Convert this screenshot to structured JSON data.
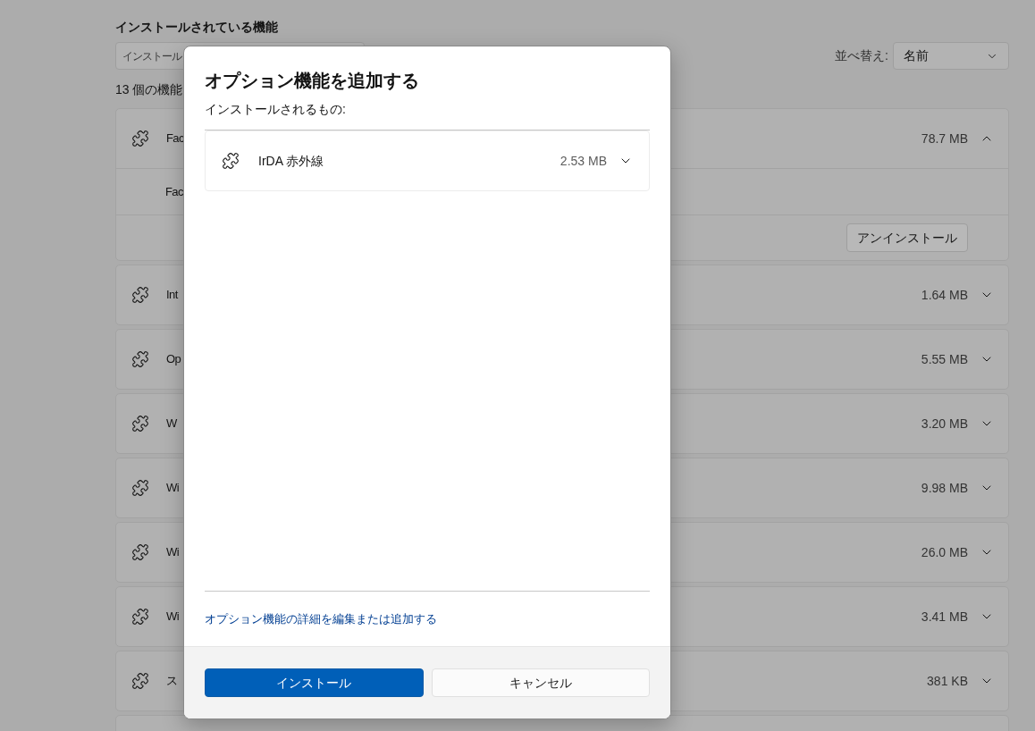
{
  "page": {
    "heading": "インストールされている機能",
    "search": {
      "placeholder": "インストール"
    },
    "sort": {
      "label": "並べ替え:",
      "value": "名前"
    },
    "count": "13 個の機能"
  },
  "features": [
    {
      "name": "Fac",
      "size": "78.7 MB",
      "expanded": true,
      "details": "Fac",
      "action": "アンインストール"
    },
    {
      "name": "Int",
      "size": "1.64 MB",
      "expanded": false
    },
    {
      "name": "Op",
      "size": "5.55 MB",
      "expanded": false
    },
    {
      "name": "W",
      "size": "3.20 MB",
      "expanded": false
    },
    {
      "name": "Wi",
      "size": "9.98 MB",
      "expanded": false
    },
    {
      "name": "Wi",
      "size": "26.0 MB",
      "expanded": false
    },
    {
      "name": "Wi",
      "size": "3.41 MB",
      "expanded": false
    },
    {
      "name": "ス",
      "size": "381 KB",
      "expanded": false
    }
  ],
  "dialog": {
    "title": "オプション機能を追加する",
    "subtitle": "インストールされるもの:",
    "items": [
      {
        "name": "IrDA 赤外線",
        "size": "2.53 MB",
        "expanded": false
      }
    ],
    "link": "オプション機能の詳細を編集または追加する",
    "buttons": [
      {
        "label": "インストール",
        "kind": "primary"
      },
      {
        "label": "キャンセル",
        "kind": "secondary"
      }
    ]
  }
}
